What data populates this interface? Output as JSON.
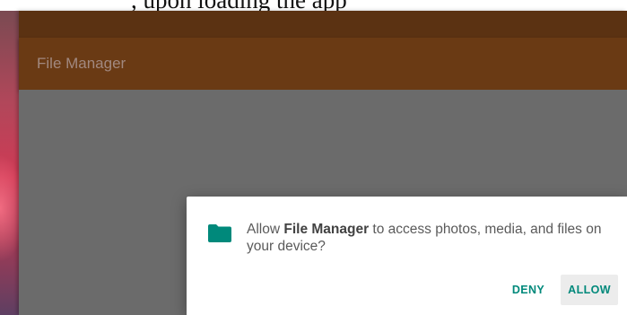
{
  "app": {
    "title": "File Manager"
  },
  "dialog": {
    "message_prefix": "Allow ",
    "app_name": "File Manager",
    "message_suffix": " to access photos, media, and files on your device?",
    "icon": "folder-icon",
    "deny_label": "DENY",
    "allow_label": "ALLOW"
  },
  "colors": {
    "status_bar": "#5b3212",
    "toolbar": "#6a3a14",
    "toolbar_title": "#a1887f",
    "content_background": "#6b6b6b",
    "accent": "#00897b"
  }
}
